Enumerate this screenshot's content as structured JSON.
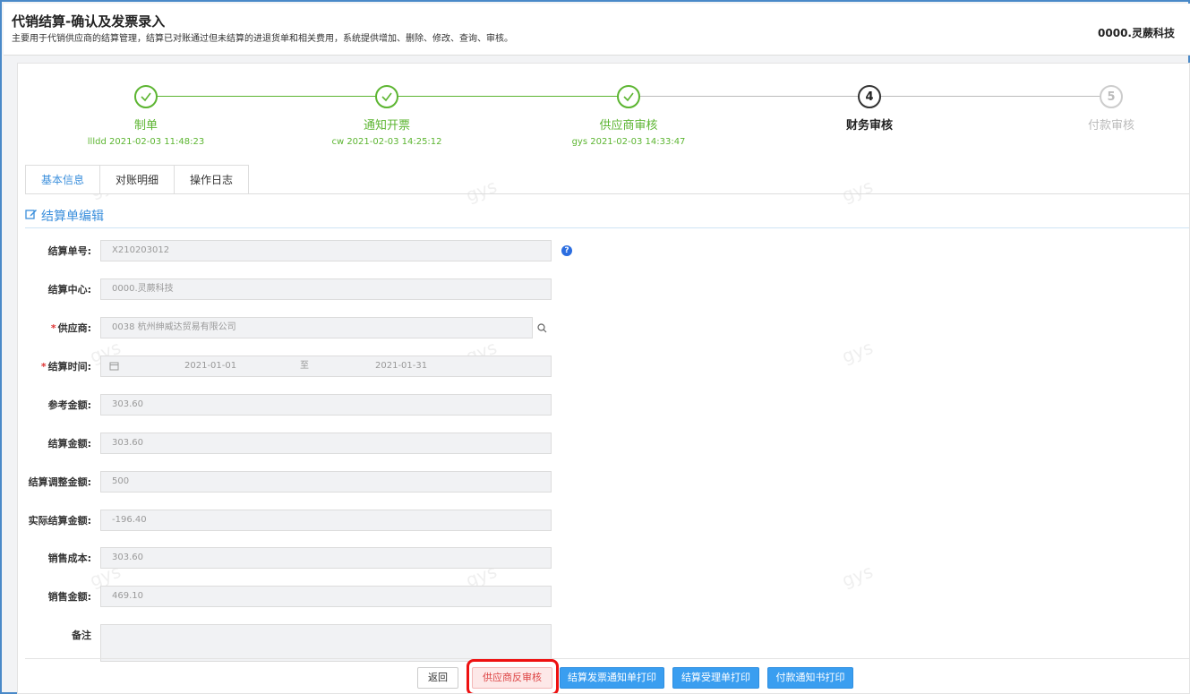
{
  "header": {
    "title": "代销结算-确认及发票录入",
    "subtitle": "主要用于代销供应商的结算管理，结算已对账通过但未结算的进退货单和相关费用，系统提供增加、删除、修改、查询、审核。",
    "company": "0000.灵蕨科技"
  },
  "steps": [
    {
      "label": "制单",
      "meta": "llldd 2021-02-03 11:48:23",
      "state": "done",
      "icon": "check-icon"
    },
    {
      "label": "通知开票",
      "meta": "cw 2021-02-03 14:25:12",
      "state": "done",
      "icon": "check-icon"
    },
    {
      "label": "供应商审核",
      "meta": "gys 2021-02-03 14:33:47",
      "state": "done",
      "icon": "check-icon"
    },
    {
      "label": "财务审核",
      "number": "4",
      "state": "current"
    },
    {
      "label": "付款审核",
      "number": "5",
      "state": "pending"
    }
  ],
  "tabs": [
    "基本信息",
    "对账明细",
    "操作日志"
  ],
  "section_title": "结算单编辑",
  "form": {
    "settle_no": {
      "label": "结算单号:",
      "value": "X210203012"
    },
    "settle_center": {
      "label": "结算中心:",
      "value": "0000.灵蕨科技"
    },
    "supplier": {
      "label": "供应商:",
      "value": "0038 杭州绅威达贸易有限公司"
    },
    "settle_time": {
      "label": "结算时间:",
      "start": "2021-01-01",
      "sep": "至",
      "end": "2021-01-31"
    },
    "ref_amount": {
      "label": "参考金额:",
      "value": "303.60"
    },
    "settle_amount": {
      "label": "结算金额:",
      "value": "303.60"
    },
    "adjust_amount": {
      "label": "结算调整金额:",
      "value": "500"
    },
    "actual_amount": {
      "label": "实际结算金额:",
      "value": "-196.40"
    },
    "sales_cost": {
      "label": "销售成本:",
      "value": "303.60"
    },
    "sales_amount": {
      "label": "销售金额:",
      "value": "469.10"
    },
    "remark": {
      "label": "备注",
      "value": ""
    }
  },
  "buttons": {
    "back": "返回",
    "supplier_reverse": "供应商反审核",
    "invoice_print": "结算发票通知单打印",
    "accept_print": "结算受理单打印",
    "payment_print": "付款通知书打印"
  },
  "watermark": "gys",
  "colors": {
    "accent": "#3b8fdc",
    "done": "#5cb531",
    "highlight": "#e11111"
  }
}
